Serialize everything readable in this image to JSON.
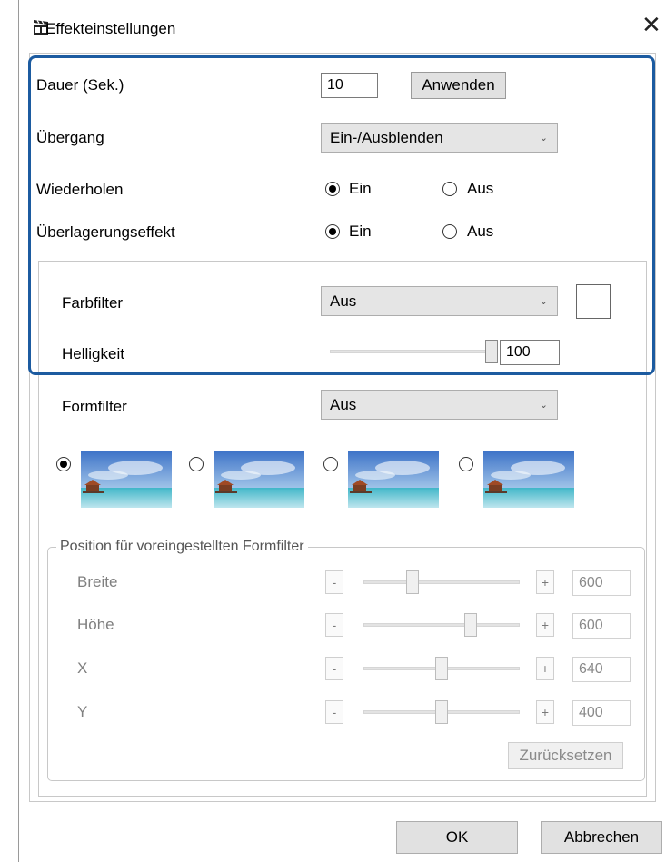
{
  "window": {
    "title": "Effekteinstellungen",
    "close_icon": "close-icon",
    "app_icon": "clapperboard-icon"
  },
  "duration": {
    "label": "Dauer (Sek.)",
    "value": "10",
    "apply_label": "Anwenden"
  },
  "transition": {
    "label": "Übergang",
    "selected": "Ein-/Ausblenden"
  },
  "repeat": {
    "label": "Wiederholen",
    "on_label": "Ein",
    "off_label": "Aus",
    "selected": "on"
  },
  "overlay": {
    "label": "Überlagerungseffekt",
    "on_label": "Ein",
    "off_label": "Aus",
    "selected": "on"
  },
  "color_filter": {
    "label": "Farbfilter",
    "selected": "Aus",
    "swatch_color": "#ffffff"
  },
  "brightness": {
    "label": "Helligkeit",
    "value": "100",
    "slider_fraction": 1.0
  },
  "shape_filter": {
    "label": "Formfilter",
    "selected": "Aus",
    "selected_preset_index": 0
  },
  "preset_position": {
    "title": "Position für voreingestellten Formfilter",
    "minus_label": "-",
    "plus_label": "+",
    "rows": [
      {
        "label": "Breite",
        "value": "600",
        "slider_fraction": 0.3
      },
      {
        "label": "Höhe",
        "value": "600",
        "slider_fraction": 0.7
      },
      {
        "label": "X",
        "value": "640",
        "slider_fraction": 0.5
      },
      {
        "label": "Y",
        "value": "400",
        "slider_fraction": 0.5
      }
    ],
    "reset_label": "Zurücksetzen"
  },
  "footer": {
    "ok_label": "OK",
    "cancel_label": "Abbrechen"
  },
  "colors": {
    "highlight": "#1c5ba0",
    "button_bg": "#e1e1e1",
    "disabled_text": "#808080"
  }
}
